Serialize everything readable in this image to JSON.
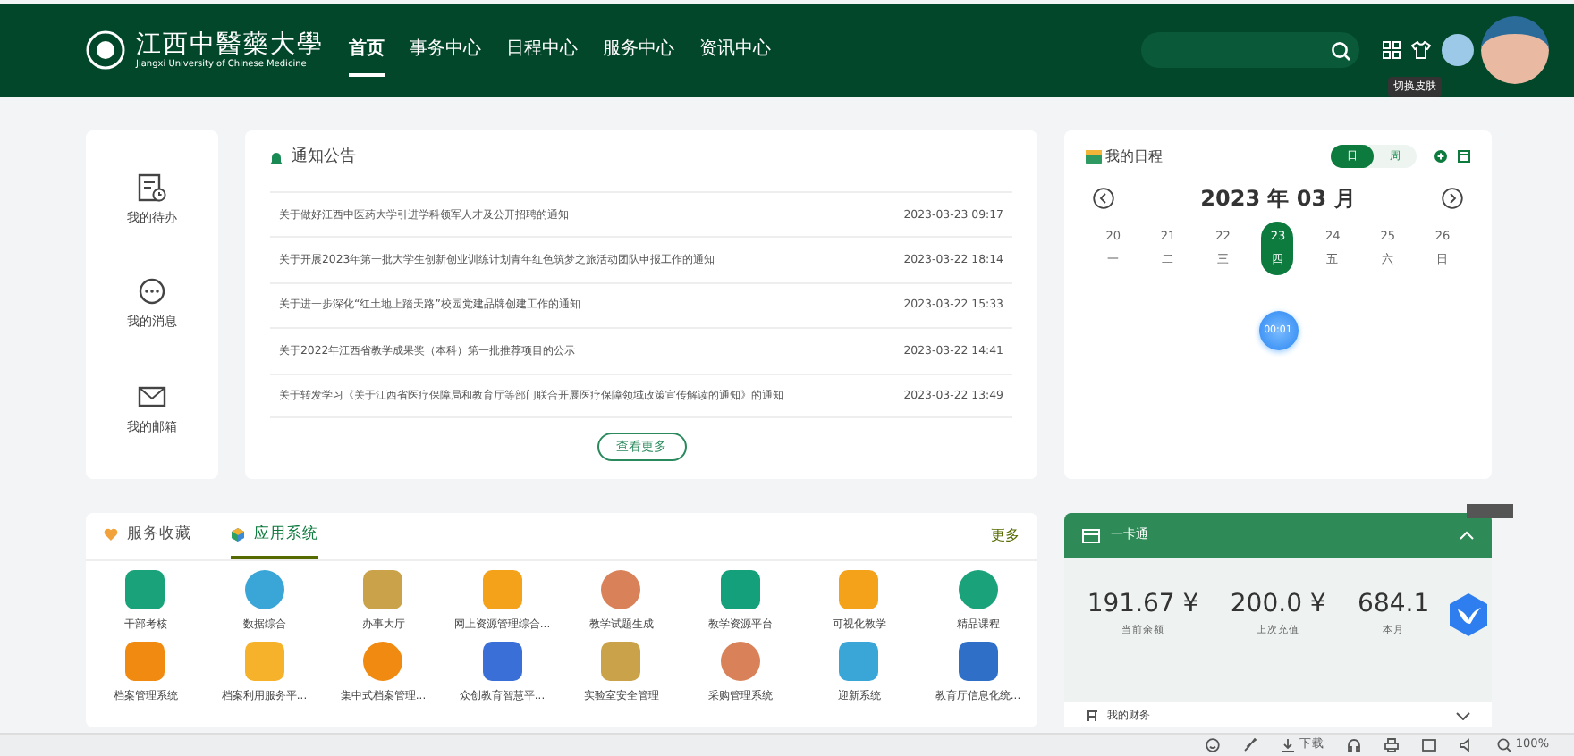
{
  "header": {
    "logo_title": "江西中醫藥大學",
    "logo_subtitle": "Jiangxi University of Chinese Medicine",
    "nav": [
      {
        "label": "首页",
        "selected": true
      },
      {
        "label": "事务中心",
        "selected": false
      },
      {
        "label": "日程中心",
        "selected": false
      },
      {
        "label": "服务中心",
        "selected": false
      },
      {
        "label": "资讯中心",
        "selected": false
      }
    ],
    "tooltip": "切换皮肤"
  },
  "quick_links": [
    {
      "label": "我的待办",
      "kind": "todo"
    },
    {
      "label": "我的消息",
      "kind": "message"
    },
    {
      "label": "我的邮箱",
      "kind": "mail"
    }
  ],
  "notices": {
    "title": "通知公告",
    "items": [
      {
        "title": "关于做好江西中医药大学引进学科领军人才及公开招聘的通知",
        "date": "2023-03-23 09:17"
      },
      {
        "title": "关于开展2023年第一批大学生创新创业训练计划青年红色筑梦之旅活动团队申报工作的通知",
        "date": "2023-03-22 18:14"
      },
      {
        "title": "关于进一步深化“红土地上踏天路”校园党建品牌创建工作的通知",
        "date": "2023-03-22 15:33"
      },
      {
        "title": "关于2022年江西省教学成果奖（本科）第一批推荐项目的公示",
        "date": "2023-03-22 14:41"
      },
      {
        "title": "关于转发学习《关于江西省医疗保障局和教育厅等部门联合开展医疗保障领域政策宣传解读的通知》的通知",
        "date": "2023-03-22 13:49"
      }
    ],
    "more": "查看更多"
  },
  "calendar": {
    "title": "我的日程",
    "views": [
      {
        "label": "日",
        "selected": true
      },
      {
        "label": "周",
        "selected": false
      }
    ],
    "month": "2023 年 03 月",
    "days": [
      {
        "date": "20",
        "weekday": "一",
        "selected": false
      },
      {
        "date": "21",
        "weekday": "二",
        "selected": false
      },
      {
        "date": "22",
        "weekday": "三",
        "selected": false
      },
      {
        "date": "23",
        "weekday": "四",
        "selected": true
      },
      {
        "date": "24",
        "weekday": "五",
        "selected": false
      },
      {
        "date": "25",
        "weekday": "六",
        "selected": false
      },
      {
        "date": "26",
        "weekday": "日",
        "selected": false
      }
    ],
    "event_time": "00:01"
  },
  "apps": {
    "tabs": [
      {
        "label": "服务收藏",
        "selected": false,
        "kind": "heart"
      },
      {
        "label": "应用系统",
        "selected": true,
        "kind": "cube"
      }
    ],
    "more": "更多",
    "items": [
      {
        "label": "干部考核",
        "color": "#1aa37a"
      },
      {
        "label": "数据综合",
        "color": "#3aa6d8"
      },
      {
        "label": "办事大厅",
        "color": "#c9a24a"
      },
      {
        "label": "网上资源管理综合...",
        "color": "#f5a21b"
      },
      {
        "label": "教学试题生成",
        "color": "#d9825a"
      },
      {
        "label": "教学资源平台",
        "color": "#13a07b"
      },
      {
        "label": "可视化教学",
        "color": "#f5a21b"
      },
      {
        "label": "精品课程",
        "color": "#1aa37a"
      },
      {
        "label": "档案管理系统",
        "color": "#f08a10"
      },
      {
        "label": "档案利用服务平...",
        "color": "#f6b22a"
      },
      {
        "label": "集中式档案管理...",
        "color": "#f08a10"
      },
      {
        "label": "众创教育智慧平...",
        "color": "#3a6fd8"
      },
      {
        "label": "实验室安全管理",
        "color": "#c9a24a"
      },
      {
        "label": "采购管理系统",
        "color": "#d9825a"
      },
      {
        "label": "迎新系统",
        "color": "#3aa6d8"
      },
      {
        "label": "教育厅信息化统...",
        "color": "#2f6fc8"
      }
    ]
  },
  "card": {
    "title": "一卡通",
    "expanded": true,
    "stats": [
      {
        "value": "191.67 ¥",
        "label": "当前余额"
      },
      {
        "value": "200.0 ¥",
        "label": "上次充值"
      },
      {
        "value": "684.1",
        "label": "本月"
      }
    ],
    "next_section": "我的财务"
  },
  "status_bar": {
    "download": "下载",
    "zoom": "100%"
  }
}
